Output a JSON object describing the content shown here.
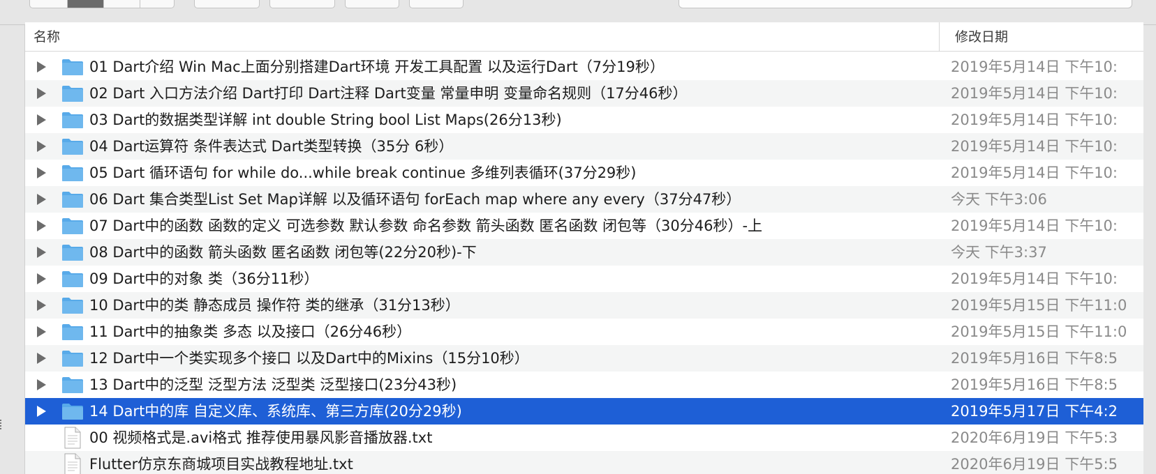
{
  "list_header": {
    "name_label": "名称",
    "date_label": "修改日期"
  },
  "colors": {
    "selection": "#1e5fd6",
    "folder": "#6fb8ee"
  },
  "rows": [
    {
      "name": "01 Dart介绍 Win Mac上面分别搭建Dart环境  开发工具配置 以及运行Dart（7分19秒）",
      "date": "2019年5月14日 下午10:",
      "kind": "folder",
      "icon": "folder-icon",
      "selected": false
    },
    {
      "name": "02 Dart 入口方法介绍 Dart打印 Dart注释  Dart变量 常量申明 变量命名规则（17分46秒）",
      "date": "2019年5月14日 下午10:",
      "kind": "folder",
      "icon": "folder-icon",
      "selected": false
    },
    {
      "name": "03 Dart的数据类型详解  int double String bool List Maps(26分13秒)",
      "date": "2019年5月14日 下午10:",
      "kind": "folder",
      "icon": "folder-icon",
      "selected": false
    },
    {
      "name": "04 Dart运算符 条件表达式 Dart类型转换（35分 6秒）",
      "date": "2019年5月14日 下午10:",
      "kind": "folder",
      "icon": "folder-icon",
      "selected": false
    },
    {
      "name": "05 Dart 循环语句 for while do...while  break continue 多维列表循环(37分29秒)",
      "date": "2019年5月14日 下午10:",
      "kind": "folder",
      "icon": "folder-icon",
      "selected": false
    },
    {
      "name": "06 Dart 集合类型List Set Map详解 以及循环语句 forEach map where any every（37分47秒）",
      "date": "今天 下午3:06",
      "kind": "folder",
      "icon": "folder-icon",
      "selected": false
    },
    {
      "name": "07 Dart中的函数  函数的定义 可选参数  默认参数  命名参数 箭头函数 匿名函数 闭包等（30分46秒）-上",
      "date": "2019年5月14日 下午10:",
      "kind": "folder",
      "icon": "folder-icon",
      "selected": false
    },
    {
      "name": "08 Dart中的函数  箭头函数 匿名函数 闭包等(22分20秒)-下",
      "date": "今天 下午3:37",
      "kind": "folder",
      "icon": "folder-icon",
      "selected": false
    },
    {
      "name": "09 Dart中的对象 类（36分11秒）",
      "date": "2019年5月14日 下午10:",
      "kind": "folder",
      "icon": "folder-icon",
      "selected": false
    },
    {
      "name": "10 Dart中的类 静态成员 操作符 类的继承（31分13秒）",
      "date": "2019年5月15日 下午11:0",
      "kind": "folder",
      "icon": "folder-icon",
      "selected": false
    },
    {
      "name": "11 Dart中的抽象类 多态 以及接口（26分46秒）",
      "date": "2019年5月15日 下午11:0",
      "kind": "folder",
      "icon": "folder-icon",
      "selected": false
    },
    {
      "name": "12 Dart中一个类实现多个接口 以及Dart中的Mixins（15分10秒）",
      "date": "2019年5月16日 下午8:5",
      "kind": "folder",
      "icon": "folder-icon",
      "selected": false
    },
    {
      "name": "13 Dart中的泛型 泛型方法  泛型类 泛型接口(23分43秒)",
      "date": "2019年5月16日 下午8:5",
      "kind": "folder",
      "icon": "folder-icon",
      "selected": false
    },
    {
      "name": "14 Dart中的库 自定义库、系统库、第三方库(20分29秒)",
      "date": "2019年5月17日 下午4:2",
      "kind": "folder",
      "icon": "folder-icon",
      "selected": true
    },
    {
      "name": "00 视频格式是.avi格式 推荐使用暴风影音播放器.txt",
      "date": "2020年6月19日 下午5:3",
      "kind": "file",
      "icon": "text-file-icon",
      "selected": false
    },
    {
      "name": "Flutter仿京东商城项目实战教程地址.txt",
      "date": "2020年6月19日 下午5:5",
      "kind": "file",
      "icon": "text-file-icon",
      "selected": false
    }
  ]
}
